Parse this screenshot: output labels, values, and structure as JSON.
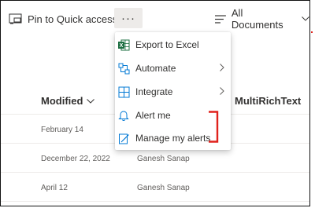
{
  "toolbar": {
    "pin_label": "Pin to Quick access",
    "more_label": "···",
    "view_label": "All Documents"
  },
  "columns": {
    "modified": "Modified",
    "rich": "MultiRichText"
  },
  "rows": [
    {
      "modified": "February 14",
      "name": ""
    },
    {
      "modified": "December 22, 2022",
      "name": "Ganesh Sanap"
    },
    {
      "modified": "April 12",
      "name": "Ganesh Sanap"
    }
  ],
  "menu": {
    "items": [
      {
        "label": "Export to Excel",
        "icon": "excel-icon"
      },
      {
        "label": "Automate",
        "icon": "automate-icon",
        "submenu": true
      },
      {
        "label": "Integrate",
        "icon": "integrate-icon",
        "submenu": true
      },
      {
        "label": "Alert me",
        "icon": "bell-icon"
      },
      {
        "label": "Manage my alerts",
        "icon": "manage-alerts-icon"
      }
    ]
  },
  "colors": {
    "excel": "#1d6f42",
    "accent": "#0078d4",
    "highlight": "#e0221c"
  }
}
